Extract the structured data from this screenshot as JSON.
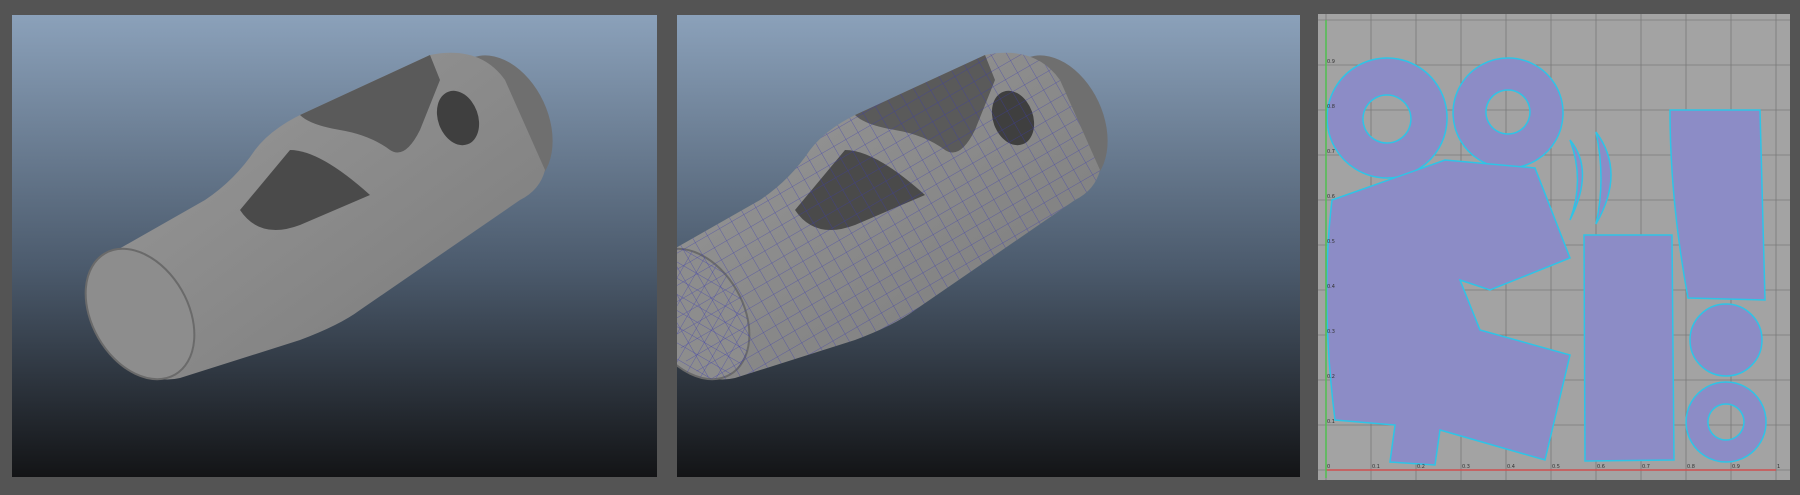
{
  "viewports": [
    {
      "name": "shaded-viewport",
      "mode": "shaded"
    },
    {
      "name": "wireframe-on-shaded-viewport",
      "mode": "wireframe-on-shaded"
    },
    {
      "name": "uv-editor",
      "mode": "uv-layout"
    }
  ],
  "uv_editor": {
    "u_ticks": [
      "0",
      "0.1",
      "0.2",
      "0.3",
      "0.4",
      "0.5",
      "0.6",
      "0.7",
      "0.8",
      "0.9",
      "1"
    ],
    "v_ticks": [
      "0.1",
      "0.2",
      "0.3",
      "0.4",
      "0.5",
      "0.6",
      "0.7",
      "0.8",
      "0.9"
    ]
  },
  "colors": {
    "app_background": "#545454",
    "viewport_top": "#8aa0b9",
    "viewport_bottom": "#141517",
    "model_gray": "#8a8a8a",
    "wire_blue": "#3a3ab0",
    "uv_background": "#a3a3a3",
    "uv_shell_fill": "#8c8cc6",
    "uv_shell_edge": "#2ec4e6",
    "u_axis": "#d05050",
    "v_axis": "#50c050"
  }
}
